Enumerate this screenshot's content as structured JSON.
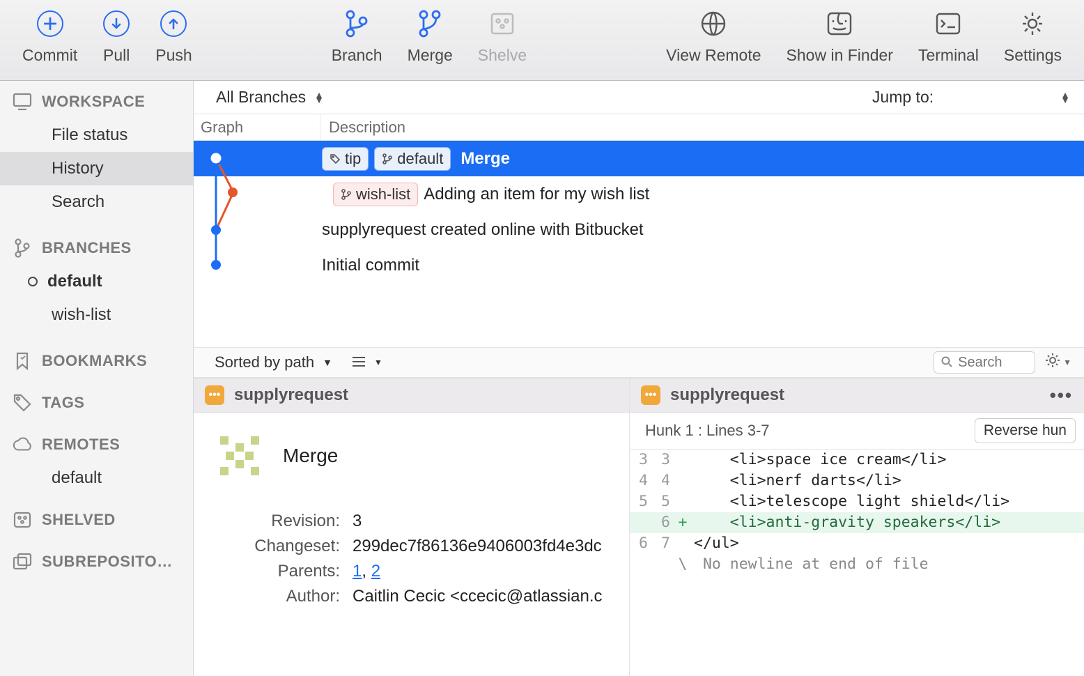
{
  "toolbar": {
    "commit": "Commit",
    "pull": "Pull",
    "push": "Push",
    "branch": "Branch",
    "merge": "Merge",
    "shelve": "Shelve",
    "view_remote": "View Remote",
    "show_in_finder": "Show in Finder",
    "terminal": "Terminal",
    "settings": "Settings"
  },
  "sidebar": {
    "workspace": {
      "header": "WORKSPACE",
      "file_status": "File status",
      "history": "History",
      "search": "Search"
    },
    "branches": {
      "header": "BRANCHES",
      "default": "default",
      "wish_list": "wish-list"
    },
    "bookmarks": {
      "header": "BOOKMARKS"
    },
    "tags": {
      "header": "TAGS"
    },
    "remotes": {
      "header": "REMOTES",
      "default": "default"
    },
    "shelved": {
      "header": "SHELVED"
    },
    "subrepos": {
      "header": "SUBREPOSITO…"
    }
  },
  "filter": {
    "all_branches": "All Branches",
    "jump_to": "Jump to:"
  },
  "hist_headers": {
    "graph": "Graph",
    "description": "Description"
  },
  "commits": [
    {
      "tags": [
        {
          "icon": "tag",
          "text": "tip"
        },
        {
          "icon": "branch",
          "text": "default"
        }
      ],
      "desc": "Merge",
      "selected": true
    },
    {
      "tags": [
        {
          "icon": "branch",
          "text": "wish-list",
          "pink": true
        }
      ],
      "desc": "Adding an item for my wish list"
    },
    {
      "tags": [],
      "desc": "supplyrequest created online with Bitbucket"
    },
    {
      "tags": [],
      "desc": "Initial commit"
    }
  ],
  "mid": {
    "sorted_by": "Sorted by path",
    "search_placeholder": "Search"
  },
  "file": {
    "name": "supplyrequest"
  },
  "details": {
    "title": "Merge",
    "revision_label": "Revision:",
    "revision": "3",
    "changeset_label": "Changeset:",
    "changeset": "299dec7f86136e9406003fd4e3dc",
    "parents_label": "Parents:",
    "parents_sep": ", ",
    "parent1": "1",
    "parent2": "2",
    "author_label": "Author:",
    "author": "Caitlin Cecic  <ccecic@atlassian.c"
  },
  "diff": {
    "hunk_label": "Hunk 1 : Lines 3-7",
    "reverse_btn": "Reverse hun",
    "lines": [
      {
        "l": "3",
        "r": "3",
        "m": " ",
        "t": "    <li>space ice cream</li>"
      },
      {
        "l": "4",
        "r": "4",
        "m": " ",
        "t": "    <li>nerf darts</li>"
      },
      {
        "l": "5",
        "r": "5",
        "m": " ",
        "t": "    <li>telescope light shield</li>"
      },
      {
        "l": "",
        "r": "6",
        "m": "+",
        "t": "    <li>anti-gravity speakers</li>",
        "added": true
      },
      {
        "l": "6",
        "r": "7",
        "m": " ",
        "t": "</ul>"
      },
      {
        "l": "",
        "r": "",
        "m": "\\",
        "t": " No newline at end of file",
        "meta": true
      }
    ]
  }
}
